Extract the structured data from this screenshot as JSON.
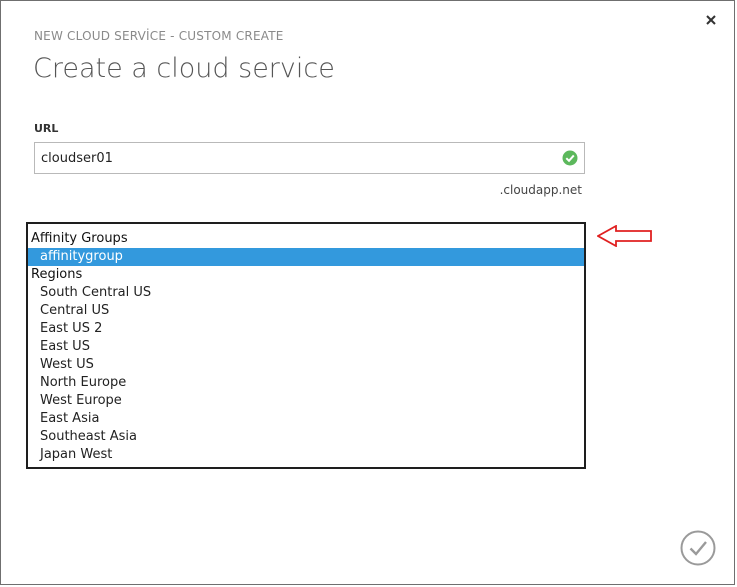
{
  "header": {
    "subtitle": "NEW CLOUD SERVİCE - CUSTOM CREATE",
    "title": "Create a cloud service"
  },
  "form": {
    "url_label": "URL",
    "url_value": "cloudser01",
    "url_suffix": ".cloudapp.net"
  },
  "dropdown": {
    "groups": [
      {
        "label": "Affinity Groups",
        "options": [
          "affinitygroup"
        ]
      },
      {
        "label": "Regions",
        "options": [
          "South Central US",
          "Central US",
          "East US 2",
          "East US",
          "West US",
          "North Europe",
          "West Europe",
          "East Asia",
          "Southeast Asia",
          "Japan West"
        ]
      }
    ],
    "selected": "affinitygroup"
  },
  "colors": {
    "accent": "#3399dd",
    "valid": "#5cb85c",
    "arrow": "#e02020"
  },
  "icons": {
    "close": "close-icon",
    "valid": "check-circle-icon",
    "arrow": "arrow-left-icon",
    "confirm": "checkmark-circle-icon"
  }
}
